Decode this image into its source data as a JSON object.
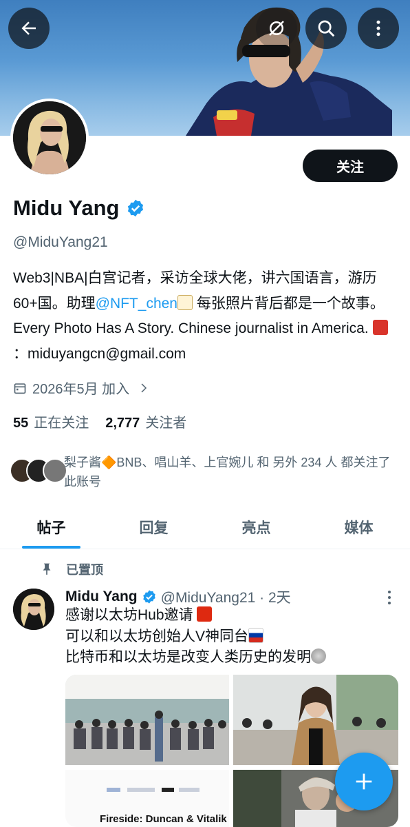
{
  "header": {
    "back_icon": "arrow-left-icon",
    "mute_icon": "no-signal-icon",
    "search_icon": "search-icon",
    "more_icon": "more-vertical-icon"
  },
  "profile": {
    "name": "Midu Yang",
    "handle": "@MiduYang21",
    "follow_label": "关注",
    "bio_part1": "Web3|NBA|白宫记者，采访全球大佬，讲六国语言，游历60+国。助理",
    "bio_link": "@NFT_chen",
    "bio_part2": " 每张照片背后都是一个故事。Every Photo Has A Story. Chinese journalist in America. ",
    "bio_part3": "：miduyangcn@gmail.com",
    "joined": "2026年5月 加入",
    "following_count": "55",
    "following_label": "正在关注",
    "followers_count": "2,777",
    "followers_label": "关注者",
    "followed_by": "梨子酱🔶BNB、唱山羊、上官婉儿 和 另外 234 人 都关注了此账号"
  },
  "tabs": [
    {
      "label": "帖子",
      "active": true
    },
    {
      "label": "回复",
      "active": false
    },
    {
      "label": "亮点",
      "active": false
    },
    {
      "label": "媒体",
      "active": false
    }
  ],
  "post": {
    "pinned_label": "已置顶",
    "author": "Midu Yang",
    "meta": "@MiduYang21 · 2天",
    "line1": "感谢以太坊Hub邀请",
    "line2": "可以和以太坊创始人V神同台",
    "line3": "比特币和以太坊是改变人类历史的发明",
    "media_caption": "Fireside: Duncan & Vitalik"
  },
  "colors": {
    "accent": "#1d9bf0",
    "text": "#0f1419",
    "muted": "#536471"
  },
  "fab_icon": "plus-icon"
}
